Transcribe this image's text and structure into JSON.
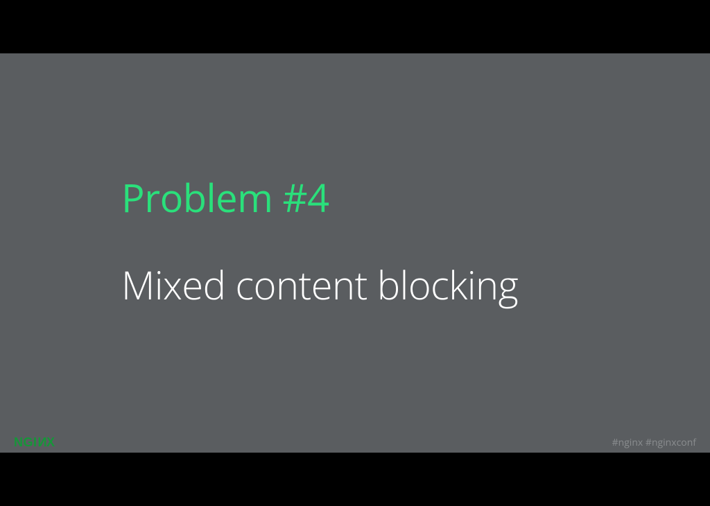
{
  "slide": {
    "heading": "Problem #4",
    "subheading": "Mixed content blocking"
  },
  "footer": {
    "logo_part1": "NGI",
    "logo_part2": "N",
    "logo_part3": "X",
    "hashtags": "#nginx  #nginxconf"
  }
}
